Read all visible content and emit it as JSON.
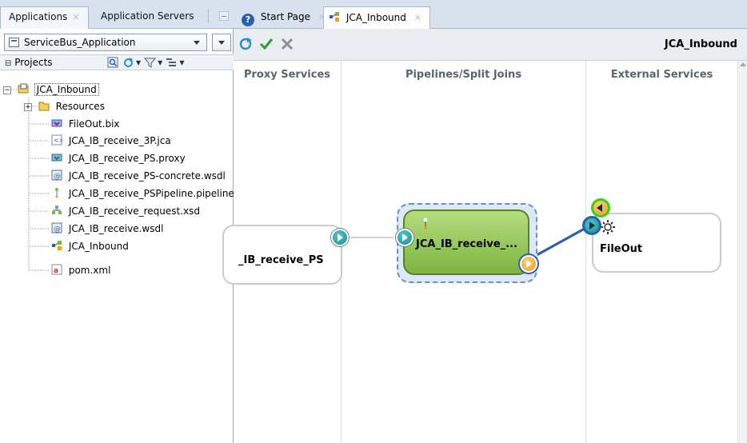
{
  "left_tabs": [
    {
      "label": "Applications"
    },
    {
      "label": "Application Servers"
    }
  ],
  "app_selector": {
    "value": "ServiceBus_Application"
  },
  "projects": {
    "title": "Projects"
  },
  "tree": [
    {
      "label": "JCA_Inbound"
    },
    {
      "label": "Resources"
    },
    {
      "label": "FileOut.bix"
    },
    {
      "label": "JCA_IB_receive_3P.jca"
    },
    {
      "label": "JCA_IB_receive_PS.proxy"
    },
    {
      "label": "JCA_IB_receive_PS-concrete.wsdl"
    },
    {
      "label": "JCA_IB_receive_PSPipeline.pipeline"
    },
    {
      "label": "JCA_IB_receive_request.xsd"
    },
    {
      "label": "JCA_IB_receive.wsdl"
    },
    {
      "label": "JCA_Inbound"
    },
    {
      "label": "pom.xml"
    }
  ],
  "editor_tabs": [
    {
      "label": "Start Page"
    },
    {
      "label": "JCA_Inbound"
    }
  ],
  "toolbar": {
    "title": "JCA_Inbound"
  },
  "lanes": [
    {
      "label": "Proxy Services"
    },
    {
      "label": "Pipelines/Split Joins"
    },
    {
      "label": "External Services"
    }
  ],
  "components": {
    "proxy": {
      "label": "_IB_receive_PS"
    },
    "pipeline": {
      "label": "JCA_IB_receive_..."
    },
    "external": {
      "label": "FileOut"
    }
  },
  "colors": {
    "accent": "#2a5fb0",
    "connector_teal": "#1b8b94",
    "connector_orange": "#f29b16",
    "pipeline_green": "#7cb53f",
    "selection_ring_green": "#2fd21a"
  }
}
